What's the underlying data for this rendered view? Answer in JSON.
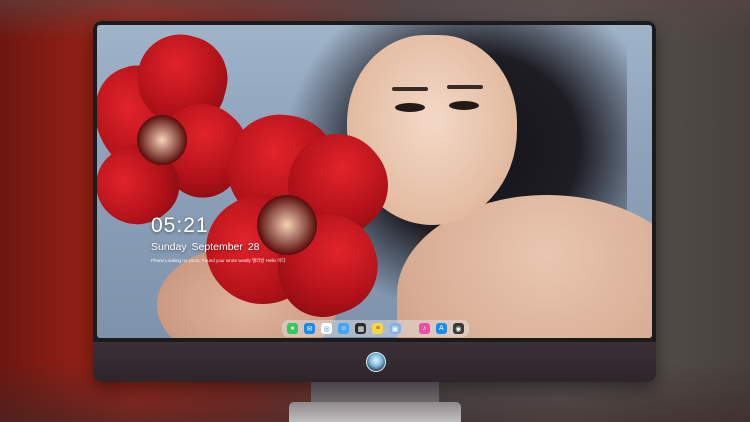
{
  "lock_screen": {
    "time": "05:21",
    "date": "Sunday September 28",
    "note": "Phone Looking no yours. Found your wrote weally 앨라방 Hello 이다"
  },
  "dock": {
    "icons": [
      {
        "name": "messages-icon",
        "color": "#34c759",
        "glyph": "💬"
      },
      {
        "name": "mail-icon",
        "color": "#1e88e5",
        "glyph": "✉"
      },
      {
        "name": "safari-icon",
        "color": "#ffffff",
        "glyph": "◎"
      },
      {
        "name": "finder-icon",
        "color": "#4aa3f0",
        "glyph": "☺"
      },
      {
        "name": "clapper-icon",
        "color": "#222222",
        "glyph": "🎬"
      },
      {
        "name": "notes-icon",
        "color": "#f7d54a",
        "glyph": "≡"
      },
      {
        "name": "preview-icon",
        "color": "#7fb4e8",
        "glyph": "▣"
      },
      {
        "name": "music-icon",
        "color": "#e94ea8",
        "glyph": "♪"
      },
      {
        "name": "app-store-icon",
        "color": "#1a8cf0",
        "glyph": "A"
      },
      {
        "name": "camera-icon",
        "color": "#3a3a3a",
        "glyph": "◉"
      }
    ]
  },
  "colors": {
    "monitor_bezel": "#1b1b1e",
    "chin": "#2d2529",
    "flower": "#d0151d"
  }
}
